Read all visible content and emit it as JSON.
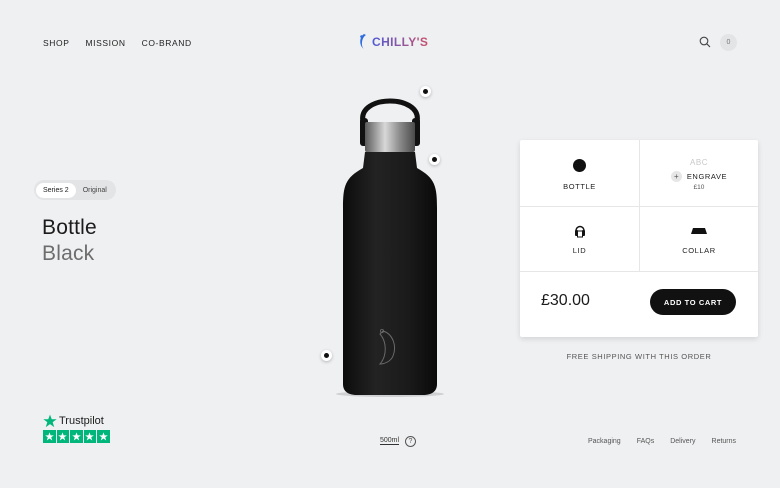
{
  "nav": {
    "items": [
      "SHOP",
      "MISSION",
      "CO-BRAND"
    ]
  },
  "logo": {
    "text": "CHILLY'S"
  },
  "header": {
    "cart_count": "0",
    "search_icon": "search-icon"
  },
  "product": {
    "series_options": [
      "Series 2",
      "Original"
    ],
    "selected_series": "Series 2",
    "title": "Bottle",
    "color": "Black",
    "size": "500ml",
    "help": "?"
  },
  "options": {
    "bottle_label": "BOTTLE",
    "engrave_preview": "ABC",
    "engrave_label": "ENGRAVE",
    "engrave_price": "£10",
    "engrave_plus": "+",
    "lid_label": "LID",
    "collar_label": "COLLAR"
  },
  "cart": {
    "price": "£30.00",
    "add_to_cart_label": "ADD TO CART",
    "shipping_note": "FREE SHIPPING WITH THIS ORDER"
  },
  "trustpilot": {
    "name": "Trustpilot",
    "rating_stars": 5
  },
  "footer": {
    "links": [
      "Packaging",
      "FAQs",
      "Delivery",
      "Returns"
    ]
  },
  "colors": {
    "accent": "#111111",
    "background": "#eff0f2",
    "trustpilot_green": "#00b67a"
  }
}
